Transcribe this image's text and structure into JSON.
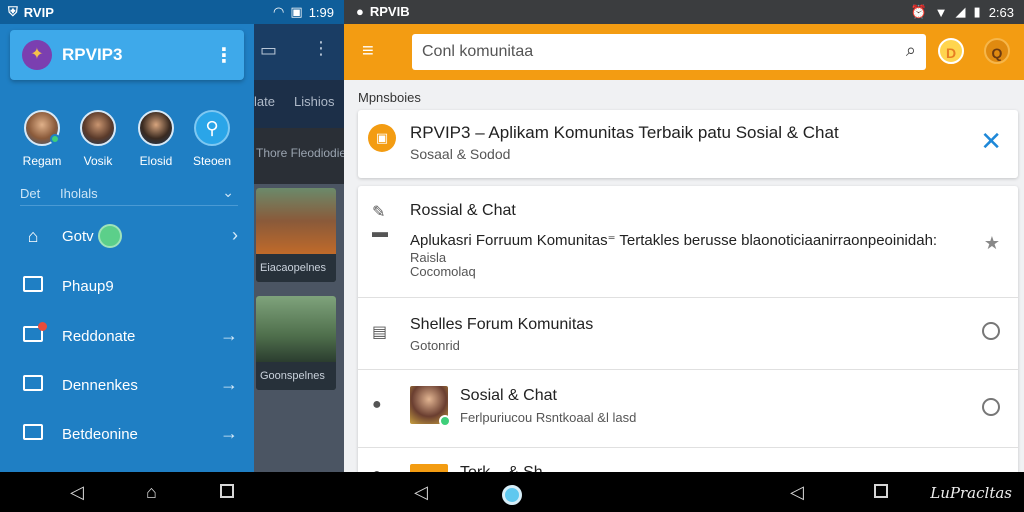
{
  "left_status": {
    "app_label": "RVIP",
    "time": "1:99"
  },
  "drawer": {
    "title": "RPVIP3",
    "avatars": [
      {
        "name": "Regam"
      },
      {
        "name": "Vosik"
      },
      {
        "name": "Elosid"
      },
      {
        "name": "Steoen"
      }
    ],
    "section": {
      "label_a": "Det",
      "label_b": "Iholals"
    },
    "items": [
      {
        "label": "Gotv",
        "icon": "home-icon"
      },
      {
        "label": "Phaup9",
        "icon": "mail-icon"
      },
      {
        "label": "Reddonate",
        "icon": "edit-icon"
      },
      {
        "label": "Dennenkes",
        "icon": "calendar-icon"
      },
      {
        "label": "Betdeonine",
        "icon": "bookmark-icon"
      }
    ]
  },
  "background_app": {
    "tab_a": "late",
    "tab_b": "Lishios",
    "subheader": "Thore Fleodiodies",
    "card1_caption": "Eiacaopelnes",
    "card2_caption": "Goonspelnes"
  },
  "right_status": {
    "app_label": "RPVIB",
    "time": "2:63"
  },
  "toolbar": {
    "search_placeholder": "Conl komunitaa",
    "badge1": "D",
    "badge2": "Q",
    "accent": "#f39c12"
  },
  "section_label": "Mpnsboies",
  "hero": {
    "title": "RPVIP3 – Aplikam Komunitas Terbaik patu Sosial & Chat",
    "subtitle": "Sosaal & Sodod"
  },
  "list": [
    {
      "title": "Rossial & Chat",
      "description": "Aplukasri Forruum Komunitas⁼ Tertakles berusse blaonoticiaanirraonpeoinidah:",
      "sub1": "Raisla",
      "sub2": "Cocomolaq"
    },
    {
      "title": "Shelles Forum Komunitas",
      "sub": "Gotonrid"
    },
    {
      "title": "Sosial & Chat",
      "sub": "Ferlpuriucou Rsntkoaal &l lasd"
    },
    {
      "title": "Tork... & Sh..."
    }
  ],
  "watermark": "LuPracltas"
}
